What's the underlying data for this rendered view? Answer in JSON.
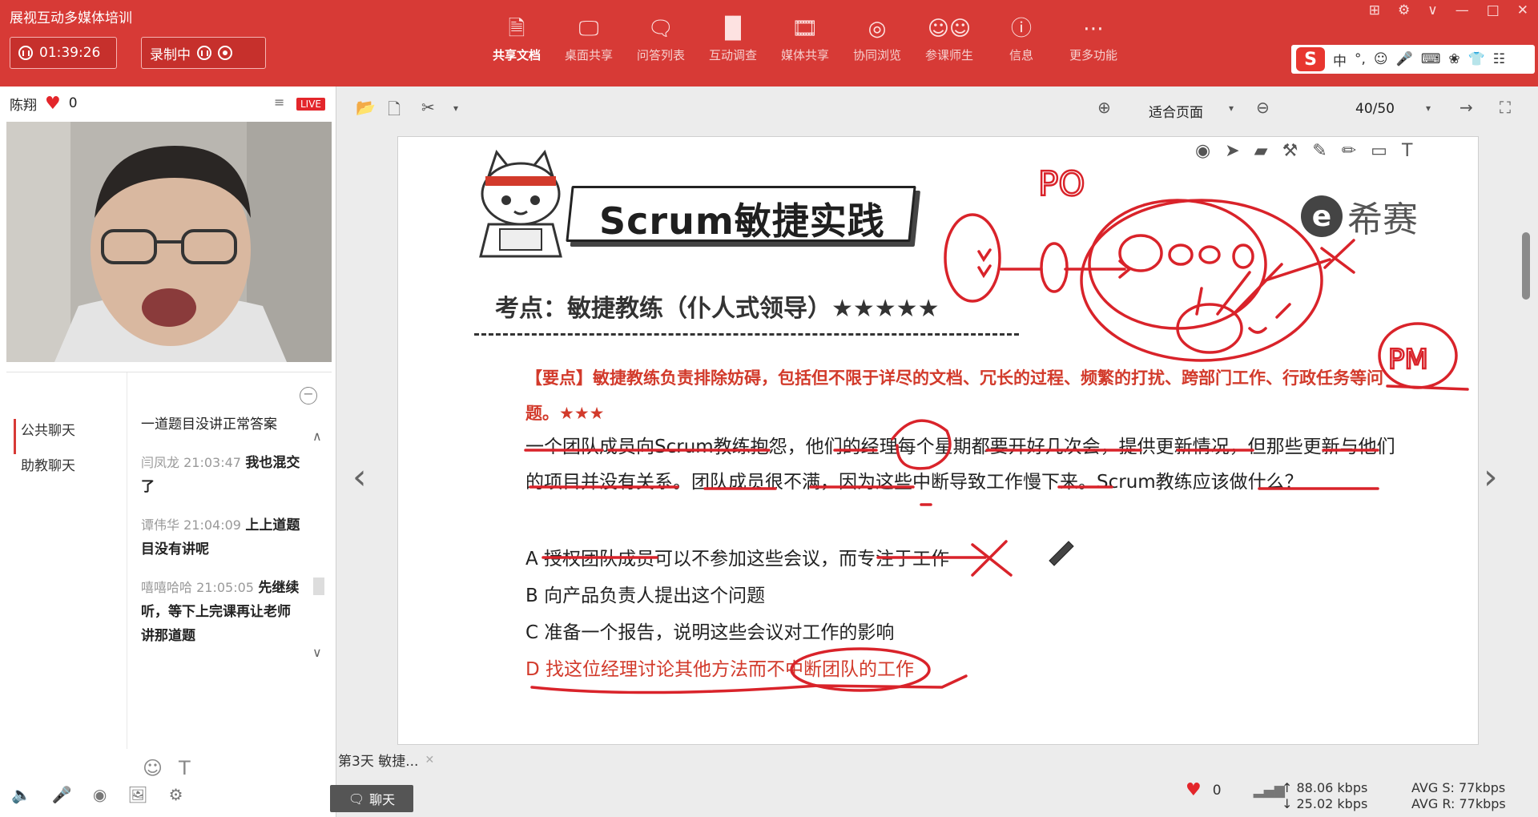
{
  "app": {
    "title": "展视互动多媒体培训"
  },
  "recording": {
    "timer": "01:39:26",
    "status": "录制中"
  },
  "toolbar": {
    "items": [
      {
        "label": "共享文档",
        "icon": "document-icon"
      },
      {
        "label": "桌面共享",
        "icon": "desktop-share-icon"
      },
      {
        "label": "问答列表",
        "icon": "qa-list-icon"
      },
      {
        "label": "互动调查",
        "icon": "survey-icon"
      },
      {
        "label": "媒体共享",
        "icon": "media-share-icon"
      },
      {
        "label": "协同浏览",
        "icon": "co-browse-icon"
      },
      {
        "label": "参课师生",
        "icon": "participants-icon"
      },
      {
        "label": "信息",
        "icon": "info-icon"
      },
      {
        "label": "更多功能",
        "icon": "more-icon"
      }
    ]
  },
  "ime": {
    "logo": "S",
    "lang": "中"
  },
  "teacher": {
    "name": "陈翔",
    "likes": "0",
    "live": "LIVE"
  },
  "chat": {
    "tabs": [
      "公共聊天",
      "助教聊天"
    ],
    "messages": [
      {
        "meta": "",
        "text": "一道题目没讲正常答案"
      },
      {
        "meta": "闫凤龙 21:03:47",
        "text": "我也混交了"
      },
      {
        "meta": "谭伟华 21:04:09",
        "text": "上上道题目没有讲呢"
      },
      {
        "meta": "嘻嘻哈哈 21:05:05",
        "text": "先继续听，等下上完课再让老师讲那道题"
      }
    ]
  },
  "doc": {
    "fit_label": "适合页面",
    "page": "40/50",
    "tab_label": "第3天 敏捷..."
  },
  "slide": {
    "title": "Scrum敏捷实践",
    "brand": "希赛",
    "brand_mark": "e",
    "subject": "考点：敏捷教练（仆人式领导）★★★★★",
    "keypoint": "【要点】敏捷教练负责排除妨碍，包括但不限于详尽的文档、冗长的过程、频繁的打扰、跨部门工作、行政任务等问题。★★★",
    "question": "一个团队成员向Scrum教练抱怨，他们的经理每个星期都要开好几次会，提供更新情况，但那些更新与他们的项目并没有关系。团队成员很不满，因为这些中断导致工作慢下来。Scrum教练应该做什么？",
    "options": [
      "A 授权团队成员可以不参加这些会议，而专注于工作",
      "B 向产品负责人提出这个问题",
      "C 准备一个报告，说明这些会议对工作的影响",
      "D 找这位经理讨论其他方法而不中断团队的工作"
    ],
    "ink_text": [
      "PO",
      "PM"
    ]
  },
  "bottom": {
    "chat_button": "聊天",
    "likes": "0",
    "upload": "88.06 kbps",
    "download": "25.02 kbps",
    "avg_s": "AVG S: 77kbps",
    "avg_r": "AVG R: 77kbps"
  },
  "colors": {
    "brand_red": "#d73a36",
    "ink_red": "#d9232a",
    "keypoint_red": "#d23a2b"
  }
}
